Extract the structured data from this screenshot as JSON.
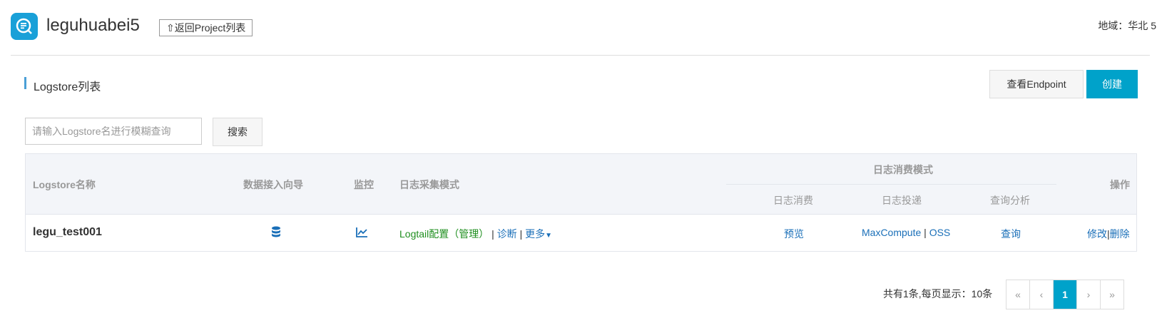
{
  "header": {
    "project_name": "leguhuabei5",
    "back_label": "返回Project列表",
    "region": "地域：华北 5"
  },
  "section": {
    "title": "Logstore列表",
    "endpoint_label": "查看Endpoint",
    "create_label": "创建"
  },
  "search": {
    "placeholder": "请输入Logstore名进行模糊查询",
    "button_label": "搜索"
  },
  "table": {
    "headers": {
      "name": "Logstore名称",
      "wizard": "数据接入向导",
      "monitor": "监控",
      "collect_mode": "日志采集模式",
      "consume_group": "日志消费模式",
      "consume": "日志消费",
      "deliver": "日志投递",
      "query": "查询分析",
      "ops": "操作"
    },
    "rows": [
      {
        "name": "legu_test001",
        "logtail_config": "Logtail配置",
        "manage": "（管理）",
        "diagnose": "诊断",
        "more": "更多",
        "preview": "预览",
        "maxcompute": "MaxCompute",
        "oss": "OSS",
        "query": "查询",
        "edit": "修改",
        "delete": "删除"
      }
    ]
  },
  "pagination": {
    "info": "共有1条,每页显示：10条",
    "first": "«",
    "prev": "‹",
    "current": "1",
    "next": "›",
    "last": "»"
  },
  "colors": {
    "accent": "#00a2ca",
    "link": "#1a6fb8",
    "green": "#1f8f1f"
  }
}
